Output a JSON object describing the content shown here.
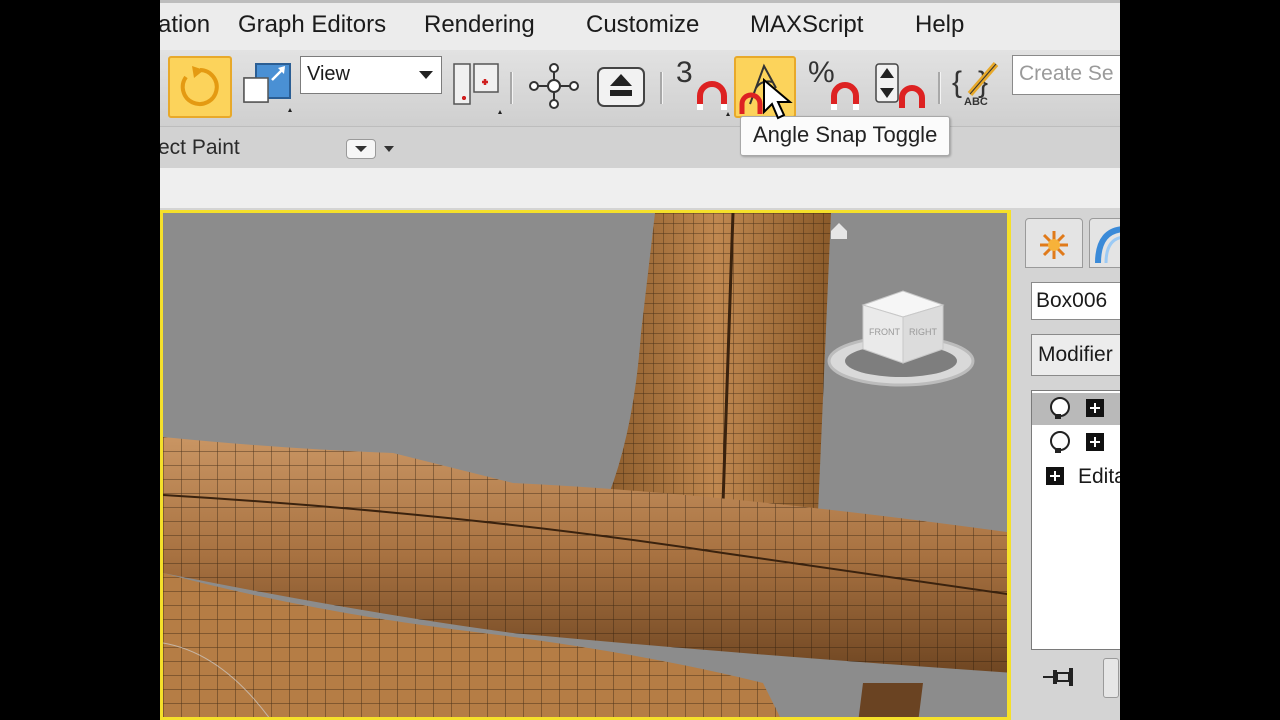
{
  "menu": {
    "items": [
      "ation",
      "Graph Editors",
      "Rendering",
      "Customize",
      "MAXScript",
      "Help"
    ]
  },
  "toolbar": {
    "reference_coord": "View",
    "snap_3d_label": "3",
    "percent_label": "%",
    "abc_label": "ABC",
    "create_selection_placeholder": "Create Se",
    "active_color": "#fcd35b"
  },
  "tooltip": {
    "text": "Angle Snap Toggle"
  },
  "ribbon": {
    "object_paint_label": "ect Paint"
  },
  "viewcube": {
    "front_label": "FRONT",
    "right_label": "RIGHT"
  },
  "command_panel": {
    "object_name": "Box006",
    "modifier_list": "Modifier",
    "stack_edit_label": "Edita"
  },
  "viewport": {
    "border_color": "#f5e02a",
    "mesh_color": "#a8743e"
  }
}
